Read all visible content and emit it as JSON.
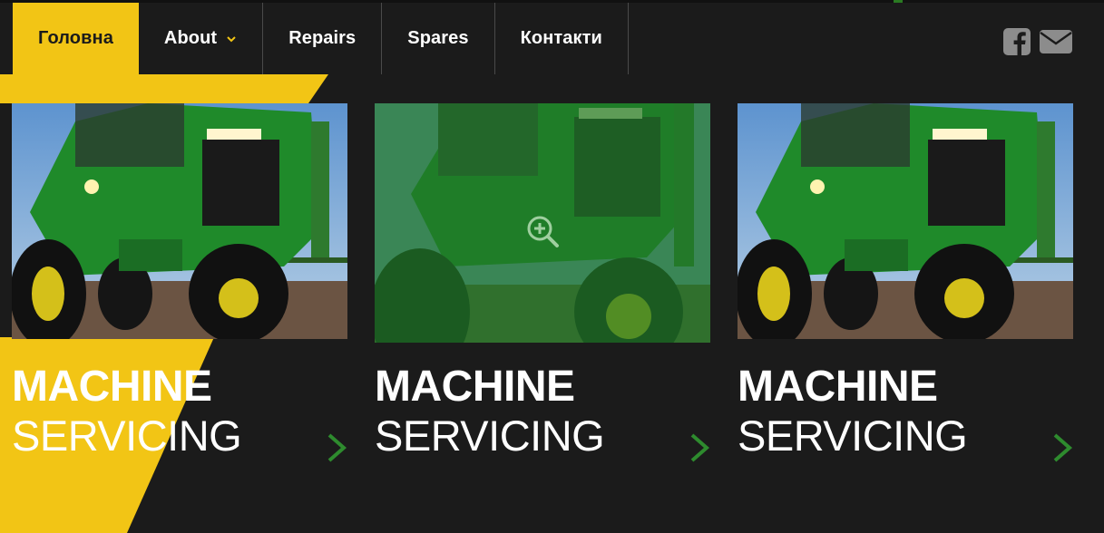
{
  "nav": {
    "items": [
      {
        "label": "Головна",
        "active": true
      },
      {
        "label": "About",
        "has_dropdown": true
      },
      {
        "label": "Repairs"
      },
      {
        "label": "Spares"
      },
      {
        "label": "Контакти"
      }
    ]
  },
  "social": {
    "icons": [
      "facebook-icon",
      "mail-icon"
    ],
    "color": "#8c8c8c"
  },
  "cards": [
    {
      "title_bold": "MACHINE",
      "title_light": "SERVICING",
      "hovered": false
    },
    {
      "title_bold": "MACHINE",
      "title_light": "SERVICING",
      "hovered": true
    },
    {
      "title_bold": "MACHINE",
      "title_light": "SERVICING",
      "hovered": false
    }
  ],
  "colors": {
    "accent_yellow": "#f2c515",
    "background": "#1b1b1b",
    "arrow_green": "#2e8b2e",
    "hover_overlay": "#207828"
  }
}
